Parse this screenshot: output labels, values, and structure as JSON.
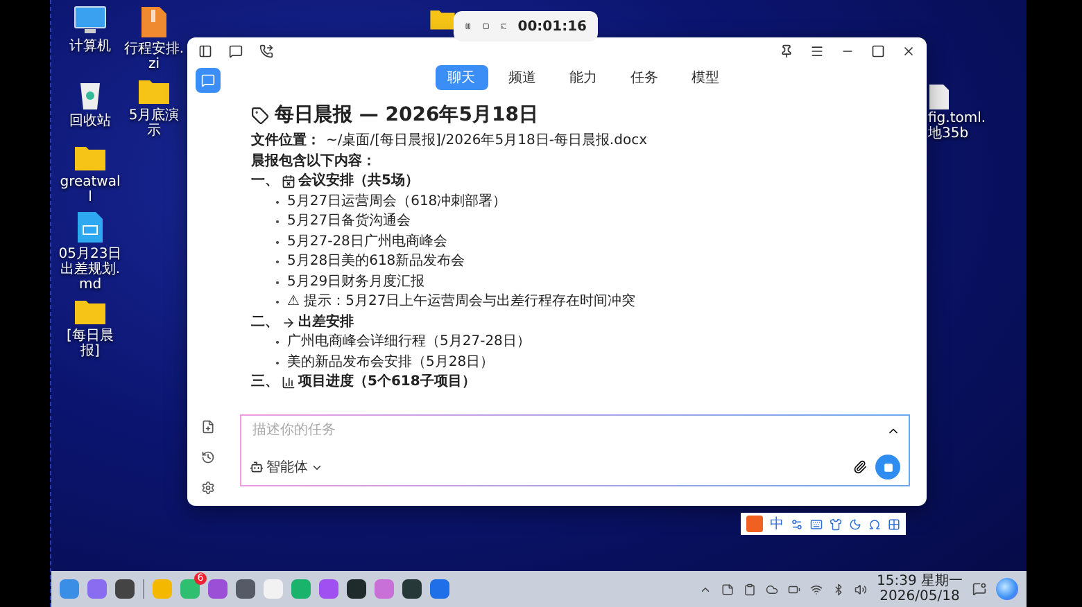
{
  "desktop": {
    "icons": [
      {
        "label": "计算机",
        "kind": "monitor"
      },
      {
        "label": "行程安排.zi",
        "kind": "zip"
      },
      {
        "label": "回收站",
        "kind": "trash"
      },
      {
        "label": "5月底演示",
        "kind": "folder"
      },
      {
        "label": "greatwall",
        "kind": "folder"
      },
      {
        "label": "05月23日出差规划.md",
        "kind": "file"
      },
      {
        "label": "[每日晨报]",
        "kind": "folder"
      }
    ],
    "partial_labels": [
      "fig.toml.",
      "地35b"
    ]
  },
  "recorder": {
    "time": "00:01:16"
  },
  "window": {
    "tabs": [
      {
        "label": "聊天",
        "selected": true
      },
      {
        "label": "频道",
        "selected": false
      },
      {
        "label": "能力",
        "selected": false
      },
      {
        "label": "任务",
        "selected": false
      },
      {
        "label": "模型",
        "selected": false
      }
    ],
    "document": {
      "heading": "每日晨报 — 2026年5月18日",
      "file_label": "文件位置：",
      "file_path": "~/桌面/[每日晨报]/2026年5月18日-每日晨报.docx",
      "intro": "晨报包含以下内容：",
      "sections": [
        {
          "number": "一、",
          "title": "会议安排（共5场）",
          "items": [
            "5月27日运营周会（618冲刺部署）",
            "5月27日备货沟通会",
            "5月27-28日广州电商峰会",
            "5月28日美的618新品发布会",
            "5月29日财务月度汇报",
            "⚠ 提示：5月27日上午运营周会与出差行程存在时间冲突"
          ]
        },
        {
          "number": "二、",
          "title": "出差安排",
          "items": [
            "广州电商峰会详细行程（5月27-28日）",
            "美的新品发布会安排（5月28日）"
          ]
        },
        {
          "number": "三、",
          "title": "项目进度（5个618子项目）"
        }
      ]
    },
    "input": {
      "placeholder": "描述你的任务",
      "agent": "智能体"
    }
  },
  "ime_bar": {
    "mode": "中"
  },
  "taskbar": {
    "apps": [
      {
        "color": "#3a8ee6"
      },
      {
        "color": "#8a6cf0"
      },
      {
        "color": "#444444"
      },
      {
        "color": "#f5b800"
      },
      {
        "color": "#2fbf71",
        "badge": "6"
      },
      {
        "color": "#9b4fd6"
      },
      {
        "color": "#555a66"
      },
      {
        "color": "#f2f2f2"
      },
      {
        "color": "#19b36b"
      },
      {
        "color": "#a04ff0"
      },
      {
        "color": "#1f2a2a"
      },
      {
        "color": "#c86fd8"
      },
      {
        "color": "#263838"
      },
      {
        "color": "#1f6fe8"
      }
    ],
    "time": "15:39 星期一",
    "date": "2026/05/18"
  }
}
